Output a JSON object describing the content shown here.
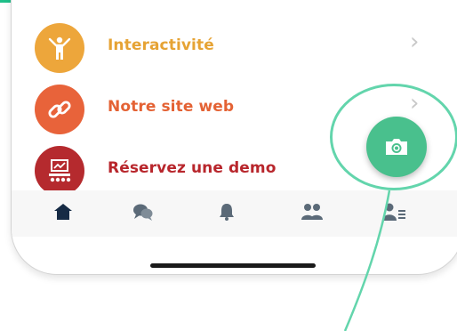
{
  "menu": {
    "items": [
      {
        "label": "Interactivité",
        "color": "#e6a334",
        "icon": "person-hands-up-icon"
      },
      {
        "label": "Notre site web",
        "color": "#e46234",
        "icon": "link-icon"
      },
      {
        "label": "Réservez une demo",
        "color": "#b8262c",
        "icon": "presentation-board-icon"
      }
    ]
  },
  "tabbar": {
    "tabs": [
      {
        "name": "home",
        "icon": "home-icon",
        "active": true
      },
      {
        "name": "chat",
        "icon": "chat-bubbles-icon"
      },
      {
        "name": "notifications",
        "icon": "bell-icon"
      },
      {
        "name": "people",
        "icon": "people-icon"
      },
      {
        "name": "profile",
        "icon": "profile-list-icon"
      }
    ]
  },
  "fab": {
    "icon": "camera-icon",
    "color": "#49c08d"
  },
  "colors": {
    "accent": "#1fc08a",
    "highlight_ring": "#63d5ac"
  }
}
